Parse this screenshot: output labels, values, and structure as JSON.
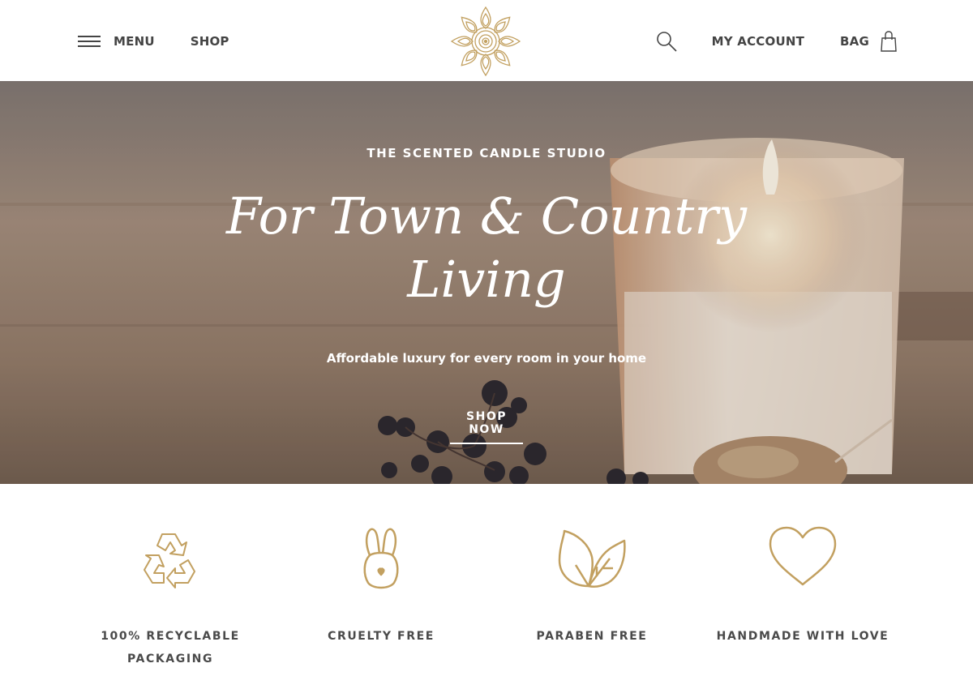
{
  "header": {
    "menu_label": "MENU",
    "shop_label": "SHOP",
    "account_label": "MY ACCOUNT",
    "bag_label": "BAG",
    "logo_icon": "mandala-logo-icon",
    "search_icon": "search-icon",
    "bag_icon": "shopping-bag-icon"
  },
  "hero": {
    "eyebrow": "THE SCENTED CANDLE STUDIO",
    "headline_line1": "For Town & Country",
    "headline_line2": "Living",
    "subline": "Affordable luxury for every room in your home",
    "cta_label": "SHOP NOW"
  },
  "features": [
    {
      "icon": "recycle-icon",
      "line1": "100% RECYCLABLE",
      "line2": "PACKAGING"
    },
    {
      "icon": "bunny-icon",
      "line1": "CRUELTY FREE",
      "line2": ""
    },
    {
      "icon": "leaf-icon",
      "line1": "PARABEN FREE",
      "line2": ""
    },
    {
      "icon": "heart-icon",
      "line1": "HANDMADE WITH LOVE",
      "line2": ""
    }
  ],
  "colors": {
    "gold": "#c2a060",
    "text": "#444444",
    "white": "#ffffff"
  }
}
